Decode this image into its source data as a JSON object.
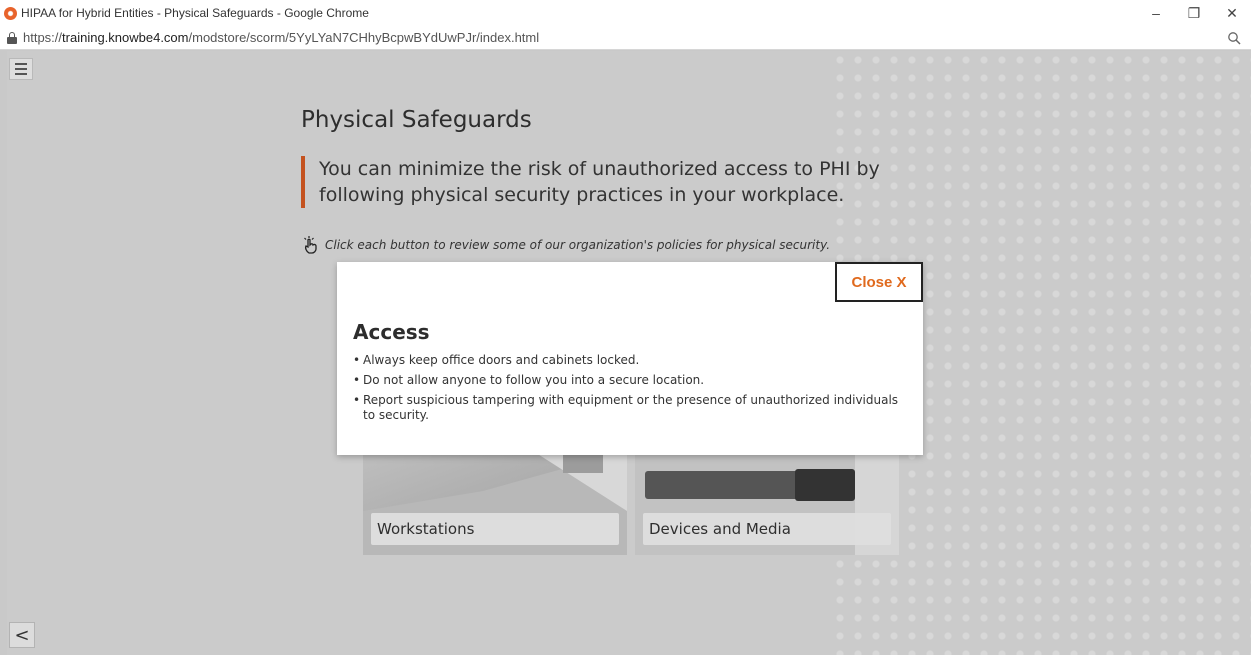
{
  "browser": {
    "window_title": "HIPAA for Hybrid Entities - Physical Safeguards - Google Chrome",
    "url_prefix": "https://",
    "url_domain": "training.knowbe4.com",
    "url_path": "/modstore/scorm/5YyLYaN7CHhyBcpwBYdUwPJr/index.html",
    "controls": {
      "minimize": "–",
      "restore": "❐",
      "close": "✕"
    }
  },
  "course": {
    "page_title": "Physical Safeguards",
    "callout": "You can minimize the risk of unauthorized access to PHI by following physical security practices in your workplace.",
    "instruction": "Click each button to review some of our organization's policies for physical security.",
    "cards": [
      {
        "label": "Workstations"
      },
      {
        "label": "Devices and Media"
      }
    ],
    "back_symbol": "<"
  },
  "modal": {
    "close_label": "Close X",
    "title": "Access",
    "items": [
      "Always keep office doors and cabinets locked.",
      "Do not allow anyone to follow you into a secure location.",
      "Report suspicious tampering with equipment or the presence of unauthorized individuals to security."
    ]
  },
  "colors": {
    "accent": "#e06a1e",
    "callout_bar": "#c4521f",
    "overlay": "#cbcbcb"
  },
  "icons": {
    "menu": "hamburger-icon",
    "tap": "tap-hand-icon",
    "back": "chevron-left-icon",
    "lock": "lock-icon",
    "zoom": "zoom-icon"
  }
}
